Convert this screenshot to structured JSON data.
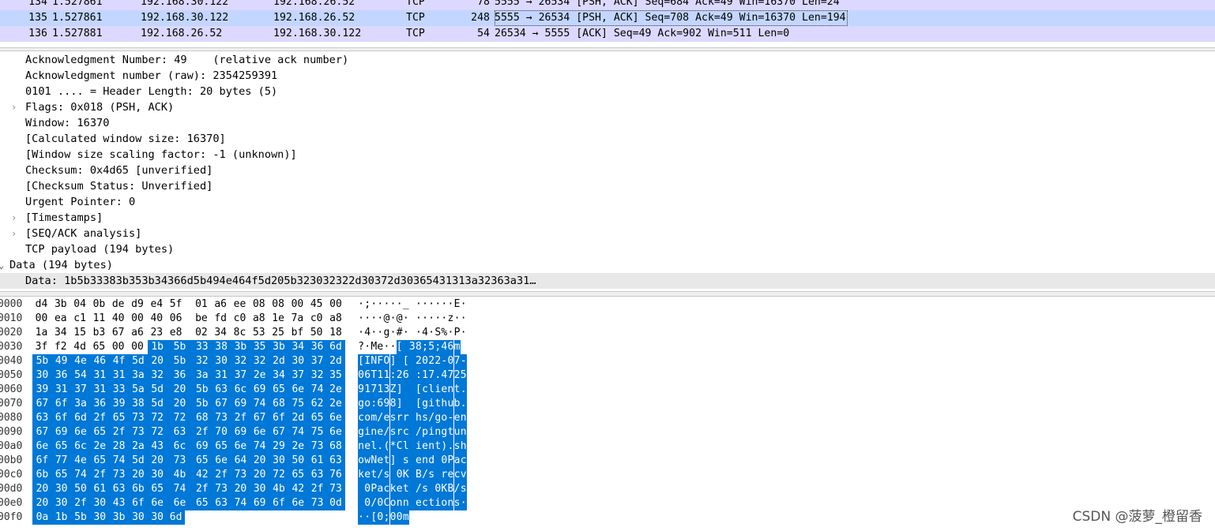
{
  "packet_list": {
    "rows": [
      {
        "no": "134",
        "time": "1.527861",
        "src": "192.168.30.122",
        "dst": "192.168.26.52",
        "proto": "TCP",
        "len": "78",
        "info": "5555 → 26534 [PSH, ACK] Seq=684 Ack=49 Win=16370 Len=24",
        "selected": false
      },
      {
        "no": "135",
        "time": "1.527861",
        "src": "192.168.30.122",
        "dst": "192.168.26.52",
        "proto": "TCP",
        "len": "248",
        "info": "5555 → 26534 [PSH, ACK] Seq=708 Ack=49 Win=16370 Len=194",
        "selected": true
      },
      {
        "no": "136",
        "time": "1.527881",
        "src": "192.168.26.52",
        "dst": "192.168.30.122",
        "proto": "TCP",
        "len": "54",
        "info": "26534 → 5555 [ACK] Seq=49 Ack=902 Win=511 Len=0",
        "selected": false
      }
    ]
  },
  "details": {
    "rows": [
      {
        "text": "Acknowledgment Number: 49    (relative ack number)",
        "expander": false
      },
      {
        "text": "Acknowledgment number (raw): 2354259391",
        "expander": false
      },
      {
        "text": "0101 .... = Header Length: 20 bytes (5)",
        "expander": false
      },
      {
        "text": "Flags: 0x018 (PSH, ACK)",
        "expander": true
      },
      {
        "text": "Window: 16370",
        "expander": false
      },
      {
        "text": "[Calculated window size: 16370]",
        "expander": false
      },
      {
        "text": "[Window size scaling factor: -1 (unknown)]",
        "expander": false
      },
      {
        "text": "Checksum: 0x4d65 [unverified]",
        "expander": false
      },
      {
        "text": "[Checksum Status: Unverified]",
        "expander": false
      },
      {
        "text": "Urgent Pointer: 0",
        "expander": false
      },
      {
        "text": "[Timestamps]",
        "expander": true
      },
      {
        "text": "[SEQ/ACK analysis]",
        "expander": true
      },
      {
        "text": "TCP payload (194 bytes)",
        "expander": false
      }
    ],
    "data_section": "Data (194 bytes)",
    "data_value": "Data: 1b5b33383b353b34366d5b494e464f5d205b323032322d30372d30365431313a32363a31…"
  },
  "bytes_pane": {
    "rows": [
      {
        "offset": "0000",
        "hex": "d4 3b 04 0b de d9 e4 5f 01 a6 ee 08 08 00 45 00",
        "ascii": "·;·····_ ······E·",
        "sel_from": 16
      },
      {
        "offset": "0010",
        "hex": "00 ea c1 11 40 00 40 06 be fd c0 a8 1e 7a c0 a8",
        "ascii": "····@·@· ·····z··",
        "sel_from": 16
      },
      {
        "offset": "0020",
        "hex": "1a 34 15 b3 67 a6 23 e8 02 34 8c 53 25 bf 50 18",
        "ascii": "·4··g·#· ·4·S%·P·",
        "sel_from": 16
      },
      {
        "offset": "0030",
        "hex": "3f f2 4d 65 00 00 1b 5b 33 38 3b 35 3b 34 36 6d",
        "ascii": "?·Me··[ 38;5;46m",
        "sel_from": 6
      },
      {
        "offset": "0040",
        "hex": "5b 49 4e 46 4f 5d 20 5b 32 30 32 32 2d 30 37 2d",
        "ascii": "[INFO] [ 2022-07-",
        "sel_from": 0
      },
      {
        "offset": "0050",
        "hex": "30 36 54 31 31 3a 32 36 3a 31 37 2e 34 37 32 35",
        "ascii": "06T11:26 :17.4725",
        "sel_from": 0
      },
      {
        "offset": "0060",
        "hex": "39 31 37 31 33 5a 5d 20 5b 63 6c 69 65 6e 74 2e",
        "ascii": "91713Z]  [client.",
        "sel_from": 0
      },
      {
        "offset": "0070",
        "hex": "67 6f 3a 36 39 38 5d 20 5b 67 69 74 68 75 62 2e",
        "ascii": "go:698]  [github.",
        "sel_from": 0
      },
      {
        "offset": "0080",
        "hex": "63 6f 6d 2f 65 73 72 72 68 73 2f 67 6f 2d 65 6e",
        "ascii": "com/esrr hs/go-en",
        "sel_from": 0
      },
      {
        "offset": "0090",
        "hex": "67 69 6e 65 2f 73 72 63 2f 70 69 6e 67 74 75 6e",
        "ascii": "gine/src /pingtun",
        "sel_from": 0
      },
      {
        "offset": "00a0",
        "hex": "6e 65 6c 2e 28 2a 43 6c 69 65 6e 74 29 2e 73 68",
        "ascii": "nel.(*Cl ient).sh",
        "sel_from": 0
      },
      {
        "offset": "00b0",
        "hex": "6f 77 4e 65 74 5d 20 73 65 6e 64 20 30 50 61 63",
        "ascii": "owNet] s end 0Pac",
        "sel_from": 0
      },
      {
        "offset": "00c0",
        "hex": "6b 65 74 2f 73 20 30 4b 42 2f 73 20 72 65 63 76",
        "ascii": "ket/s 0K B/s recv",
        "sel_from": 0
      },
      {
        "offset": "00d0",
        "hex": "20 30 50 61 63 6b 65 74 2f 73 20 30 4b 42 2f 73",
        "ascii": " 0Packet /s 0KB/s",
        "sel_from": 0
      },
      {
        "offset": "00e0",
        "hex": "20 30 2f 30 43 6f 6e 6e 65 63 74 69 6f 6e 73 0d",
        "ascii": " 0/0Conn ections·",
        "sel_from": 0
      },
      {
        "offset": "00f0",
        "hex": "0a 1b 5b 30 3b 30 30 6d",
        "ascii": "··[0;00m",
        "sel_from": 0
      }
    ]
  },
  "watermark": "CSDN @菠萝_橙留香",
  "colors": {
    "selection": "#0078d7",
    "selected_packet_row": "#c3d6ff",
    "tcp_row": "#dcd8ff"
  }
}
